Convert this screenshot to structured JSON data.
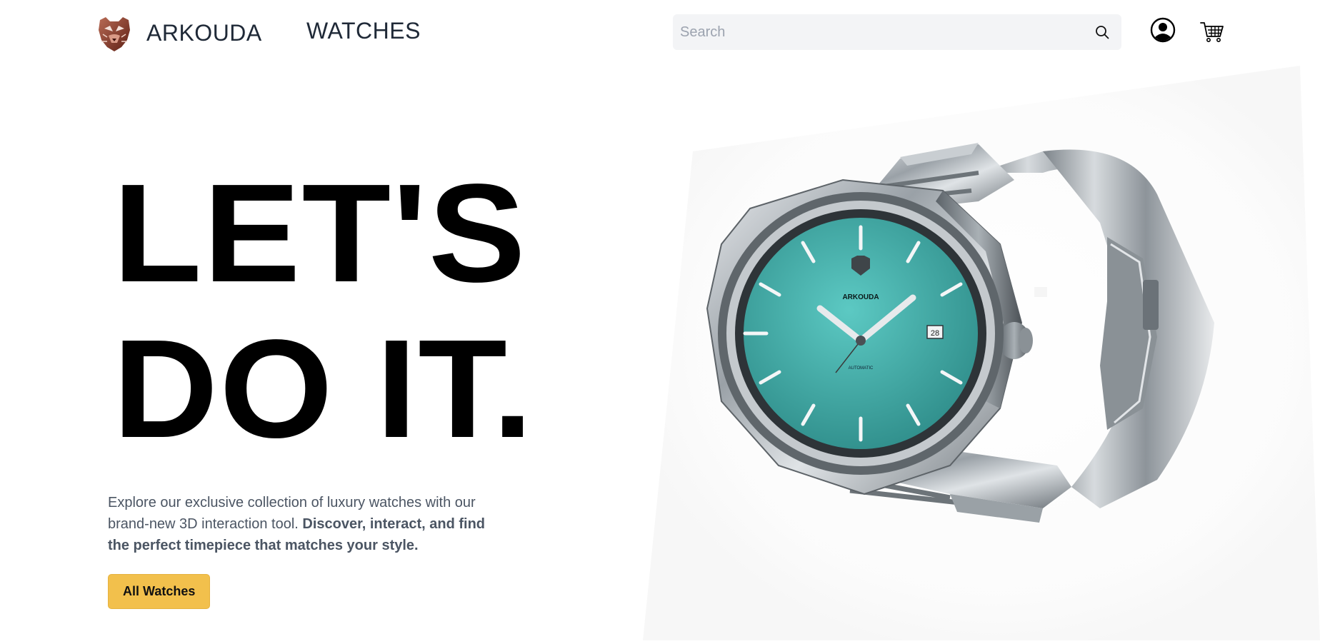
{
  "header": {
    "brand_name": "ARKOUDA",
    "nav_watches": "WATCHES",
    "search_placeholder": "Search",
    "icons": {
      "logo": "bear-logo-icon",
      "search": "search-icon",
      "account": "user-circle-icon",
      "cart": "shopping-cart-icon"
    }
  },
  "hero": {
    "headline_line1": "LET'S",
    "headline_line2": "DO IT.",
    "description_plain": "Explore our exclusive collection of luxury watches with our brand-new 3D interaction tool.",
    "description_bold": "Discover, interact, and find the perfect timepiece that matches your style.",
    "cta_label": "All Watches"
  },
  "watch": {
    "dial_brand": "ARKOUDA",
    "dial_text": "AUTOMATIC",
    "date": "28",
    "dial_color": "#45b5b0"
  },
  "colors": {
    "cta": "#f2c04c",
    "search_bg": "#f3f4f6",
    "text_primary": "#000000",
    "text_secondary": "#4b5563",
    "logo_brown": "#8b3b2a"
  }
}
